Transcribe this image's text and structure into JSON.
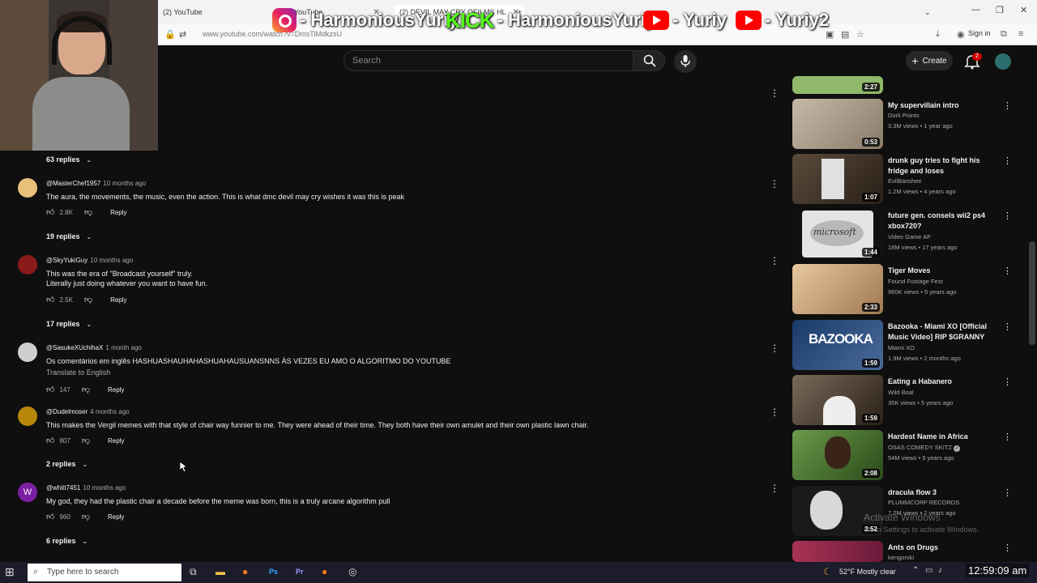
{
  "browser": {
    "tabs": [
      {
        "label": "(2) YouTube"
      },
      {
        "label": "YouTube"
      },
      {
        "label": "(2) DEVIL MAY CRY OFILMS HL"
      }
    ],
    "url": "www.youtube.com/watch?v=DmsTiMdkzsU",
    "signin_label": "Sign in"
  },
  "overlay": {
    "instagram": "- HarmoniousYuriy",
    "kick_logo": "KICK",
    "kick": "- HarmoniousYuriy",
    "youtube1": "- Yuriy",
    "youtube2": "- Yuriy2"
  },
  "header": {
    "search_placeholder": "Search",
    "create_label": "Create",
    "notif_count": "2"
  },
  "comments": [
    {
      "replies": "63 replies"
    },
    {
      "author": "@MasterChef1957",
      "time": "10 months ago",
      "text": [
        "The aura, the movements, the music, even the action. This is what dmc devil may cry wishes it was this is peak"
      ],
      "likes": "2.8K",
      "reply_label": "Reply",
      "replies": "19 replies",
      "avatar_letter": "",
      "avatar_color": "#e8c07a"
    },
    {
      "author": "@SkyYukiGuy",
      "time": "10 months ago",
      "text": [
        "This was the era of \"Broadcast yourself\" truly.",
        "Literally just doing whatever you want to have fun."
      ],
      "likes": "2.5K",
      "reply_label": "Reply",
      "replies": "17 replies",
      "avatar_letter": "",
      "avatar_color": "#8b1a1a"
    },
    {
      "author": "@SasukeXUchihaX",
      "time": "1 month ago",
      "text": [
        "Os comentários em inglês HASHUASHAUHAHASHUAHAUSUANSNNS ÀS VEZES EU AMO O ALGORITMO DO YOUTUBE"
      ],
      "translate": "Translate to English",
      "likes": "147",
      "reply_label": "Reply",
      "avatar_letter": "",
      "avatar_color": "#cfcfcf"
    },
    {
      "author": "@Dudelmoser",
      "time": "4 months ago",
      "text": [
        "This makes the Vergil memes with that style of chair way funnier to me. They were ahead of their time. They both have their own amulet and their own plastic lawn chair."
      ],
      "likes": "807",
      "reply_label": "Reply",
      "replies": "2 replies",
      "avatar_letter": "",
      "avatar_color": "#b8860b"
    },
    {
      "author": "@whitt7451",
      "time": "10 months ago",
      "text": [
        "My god, they had the plastic chair a decade before the meme was born, this is a truly arcane algorithm pull"
      ],
      "likes": "960",
      "reply_label": "Reply",
      "replies": "6 replies",
      "avatar_letter": "W",
      "avatar_color": "#7b1fa2"
    }
  ],
  "sidebar": [
    {
      "title": "",
      "channel": "",
      "meta": "",
      "duration": "2:27",
      "thumb": "#8fb86a"
    },
    {
      "title": "My supervillain intro",
      "channel": "Dork Points",
      "meta": "3.3M views • 1 year ago",
      "duration": "0:53",
      "thumb": "#b0a090"
    },
    {
      "title": "drunk guy tries to fight his fridge and loses",
      "channel": "EvilBanshee",
      "meta": "1.2M views • 4 years ago",
      "duration": "1:07",
      "thumb": "#6a5a4a"
    },
    {
      "title": "future gen. consels wii2 ps4 xbox720?",
      "channel": "Video Game AF",
      "meta": "18M views • 17 years ago",
      "duration": "1:44",
      "thumb": "#d8d8d8",
      "thumb_text": "microsoft"
    },
    {
      "title": "Tiger Moves",
      "channel": "Found Footage Fest",
      "meta": "960K views • 5 years ago",
      "duration": "2:33",
      "thumb": "#c8a880"
    },
    {
      "title": "Bazooka - Miami XO [Official Music Video] RIP $GRANNY",
      "channel": "Miami XO",
      "meta": "1.9M views • 2 months ago",
      "duration": "1:59",
      "thumb": "#2a4a7a",
      "thumb_text": "BAZOOKA"
    },
    {
      "title": "Eating a Habanero",
      "channel": "Wild Boal",
      "meta": "35K views • 5 years ago",
      "duration": "1:59",
      "thumb": "#4a3a2a"
    },
    {
      "title": "Hardest Name in Africa",
      "channel": "OSAS COMEDY SKITZ",
      "meta": "54M views • 9 years ago",
      "duration": "2:08",
      "thumb": "#4a7a3a"
    },
    {
      "title": "dracula flow 3",
      "channel": "PLUMMCORP RECORDS",
      "meta": "7.2M views • 2 years ago",
      "duration": "3:52",
      "thumb": "#222222"
    },
    {
      "title": "Ants on Drugs",
      "channel": "kengorski",
      "meta": "",
      "duration": "",
      "thumb": "#aa3355"
    }
  ],
  "activate": {
    "title": "Activate Windows",
    "subtitle": "Go to Settings to activate Windows."
  },
  "taskbar": {
    "search_placeholder": "Type here to search",
    "weather": "52°F  Mostly clear",
    "clock": "12:59:09 am"
  }
}
